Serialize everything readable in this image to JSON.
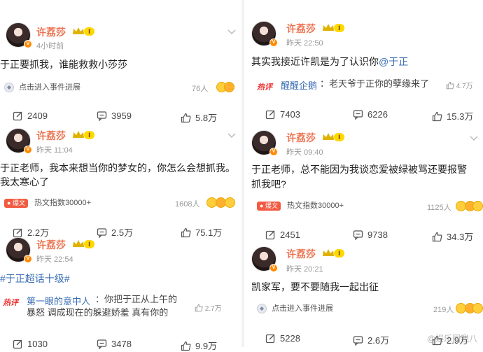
{
  "posts": [
    {
      "user": "许荔莎",
      "level": "Ⅰ",
      "time": "4小时前",
      "content": "于正要抓我，谁能救救小莎莎",
      "event": "点击进入事件进展",
      "reaction_count": "76人",
      "stats": {
        "repost": "2409",
        "comment": "3959",
        "like": "5.8万"
      }
    },
    {
      "user": "许荔莎",
      "level": "Ⅰ",
      "time": "昨天 11:04",
      "content_line1": "于正老师，我本来想当你的梦女的，你怎么会想抓我。",
      "content_line2": "我太寒心了",
      "hot_badge": "爆文",
      "hot_text": "热文指数30000+",
      "reaction_count": "1608人",
      "stats": {
        "repost": "2.2万",
        "comment": "2.5万",
        "like": "75.1万"
      }
    },
    {
      "user": "许荔莎",
      "level": "Ⅰ",
      "time": "昨天 22:54",
      "topic": "#于正超话十级#",
      "reco_label": "热评",
      "reco_name": "第一眼的意中人",
      "reco_text1": "：你把于正从上午的",
      "reco_text2": "暴怒 调成现在的躲避娇羞 真有你的",
      "reco_likes": "2.7万",
      "stats": {
        "repost": "1030",
        "comment": "3478",
        "like": "9.9万"
      }
    },
    {
      "user": "许荔莎",
      "level": "Ⅰ",
      "time": "昨天 22:50",
      "content_prefix": "其实我接近许凯是为了认识你",
      "content_mention": "@于正",
      "reco_label": "热评",
      "reco_name": "醒醒企鹅",
      "reco_text": "：老天爷于正你的孽缘来了",
      "reco_likes": "4.7万",
      "stats": {
        "repost": "7403",
        "comment": "6226",
        "like": "15.3万"
      }
    },
    {
      "user": "许荔莎",
      "level": "Ⅰ",
      "time": "昨天 09:40",
      "content_line1": "于正老师，总不能因为我谈恋爱被绿被骂还要报警",
      "content_line2": "抓我吧?",
      "hot_badge": "爆文",
      "hot_text": "热文指数30000+",
      "reaction_count": "1125人",
      "stats": {
        "repost": "2451",
        "comment": "9738",
        "like": "34.3万"
      }
    },
    {
      "user": "许荔莎",
      "level": "Ⅰ",
      "time": "昨天 20:21",
      "content": "凯家军，要不要随我一起出征",
      "event": "点击进入事件进展",
      "reaction_count": "219人",
      "stats": {
        "repost": "5228",
        "comment": "2.6万",
        "like": "2.9万"
      }
    }
  ],
  "watermark": "@娱乐圈我八",
  "colors": {
    "name": "#eb7350",
    "link": "#3b6fb6",
    "hot": "#f25a42",
    "level": "#ffd800"
  }
}
